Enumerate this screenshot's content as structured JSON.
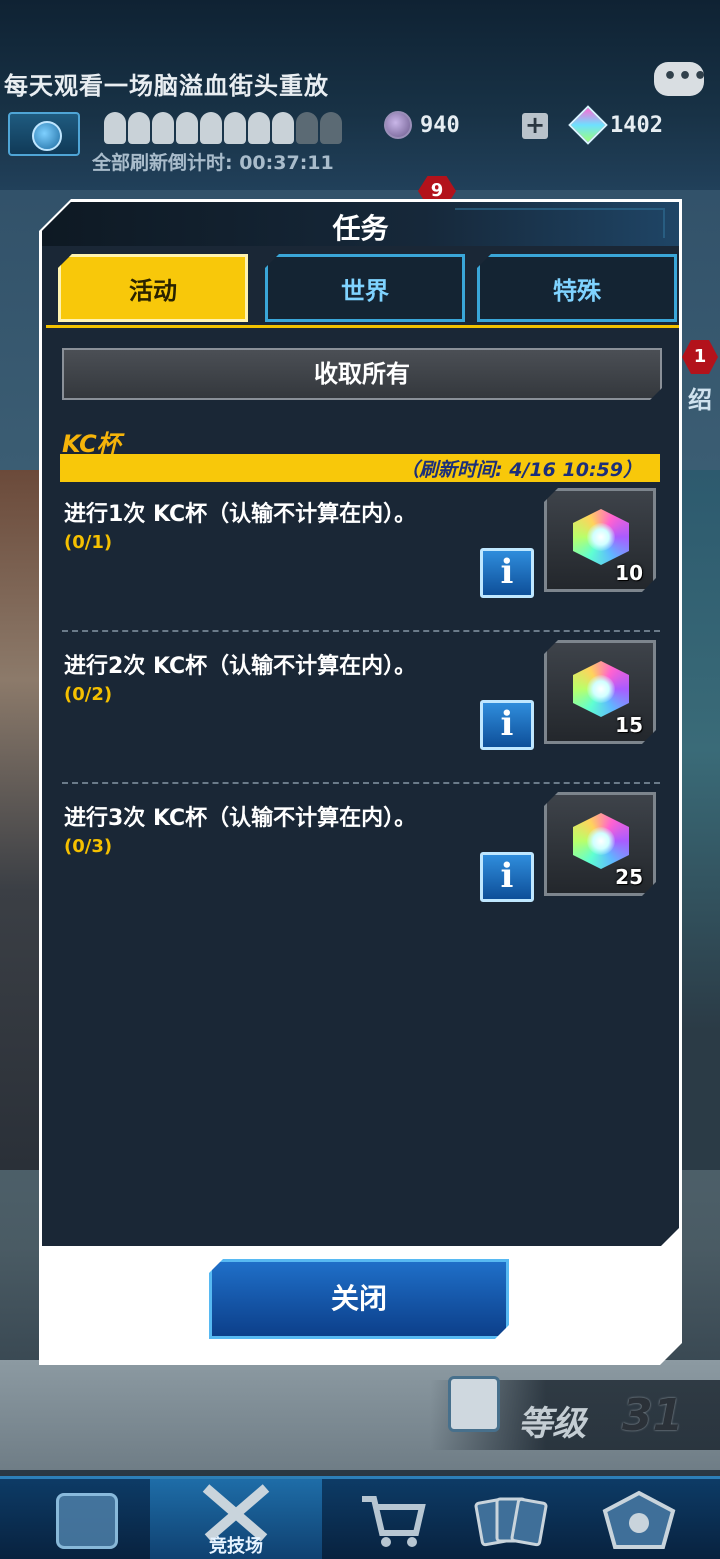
{
  "top": {
    "marquee": "每天观看一场脑溢血街头重放",
    "coins": "940",
    "gems": "1402",
    "plus_label": "+",
    "refresh_countdown": "全部刷新倒计时: 00:37:11",
    "badge_count": "9",
    "side_badge": "1",
    "side_text": "绍"
  },
  "dialog": {
    "title": "任务",
    "tabs": [
      {
        "label": "活动",
        "active": true
      },
      {
        "label": "世界",
        "active": false
      },
      {
        "label": "特殊",
        "active": false
      }
    ],
    "collect_all": "收取所有",
    "section_title": "KC杯",
    "refresh_time": "（刷新时间: 4/16 10:59）",
    "tasks": [
      {
        "desc": "进行1次 KC杯（认输不计算在内）。",
        "progress": "(0/1)",
        "reward": "10"
      },
      {
        "desc": "进行2次 KC杯（认输不计算在内）。",
        "progress": "(0/2)",
        "reward": "15"
      },
      {
        "desc": "进行3次 KC杯（认输不计算在内）。",
        "progress": "(0/3)",
        "reward": "25"
      }
    ],
    "info_label": "i",
    "close": "关闭"
  },
  "level": {
    "label": "等级",
    "value": "31"
  },
  "bottom_nav": {
    "items": [
      {
        "label": "",
        "icon": "profile-gear-icon"
      },
      {
        "label": "竞技场",
        "icon": "crossed-swords-icon"
      },
      {
        "label": "",
        "icon": "shopping-cart-icon"
      },
      {
        "label": "",
        "icon": "cards-icon"
      },
      {
        "label": "",
        "icon": "emblem-icon"
      }
    ]
  },
  "colors": {
    "accent": "#f8c80a",
    "panel": "#1a2736",
    "button_blue": "#1f6fc8",
    "gem_progress": "#f5c000"
  }
}
